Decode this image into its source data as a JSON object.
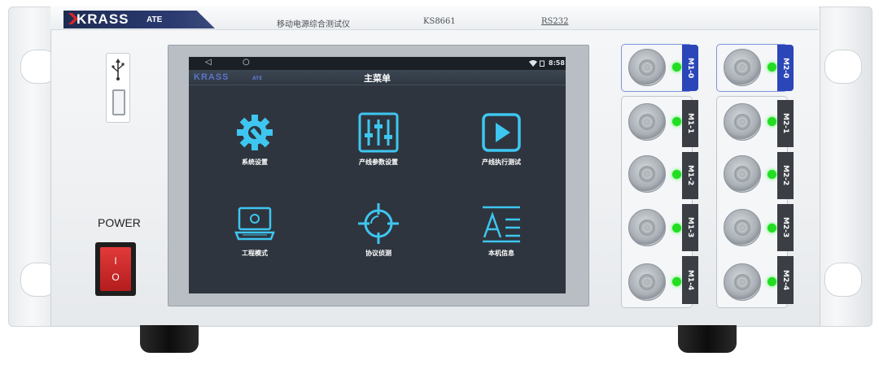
{
  "brand": {
    "name": "KRASS",
    "suffix": "ATE"
  },
  "front_panel": {
    "device_name": "移动电源综合测试仪",
    "model": "KS8661",
    "port_label": "RS232",
    "power_label": "POWER",
    "switch_on": "I",
    "switch_off": "O"
  },
  "screen": {
    "status_time": "8:58",
    "back_glyph": "◁",
    "home_glyph": "○",
    "title": "主菜单",
    "brand_name": "KRASS",
    "brand_suffix": "ATE",
    "menu_items": [
      {
        "label": "系统设置",
        "icon": "gear-wrench-icon"
      },
      {
        "label": "产线参数设置",
        "icon": "sliders-icon"
      },
      {
        "label": "产线执行测试",
        "icon": "play-icon"
      },
      {
        "label": "工程模式",
        "icon": "laptop-icon"
      },
      {
        "label": "协议侦测",
        "icon": "crosshair-icon"
      },
      {
        "label": "本机信息",
        "icon": "text-info-icon"
      }
    ]
  },
  "ports": {
    "group1": [
      "M1-0",
      "M1-1",
      "M1-2",
      "M1-3",
      "M1-4"
    ],
    "group2": [
      "M2-0",
      "M2-1",
      "M2-2",
      "M2-3",
      "M2-4"
    ],
    "led_color": "#22dd22",
    "highlight_color": "#2b46b8"
  },
  "colors": {
    "screen_bg": "#2e353e",
    "icon_cyan": "#3ec6f0",
    "brand_navy": "#1d2b52",
    "power_red": "#d42a2a"
  }
}
